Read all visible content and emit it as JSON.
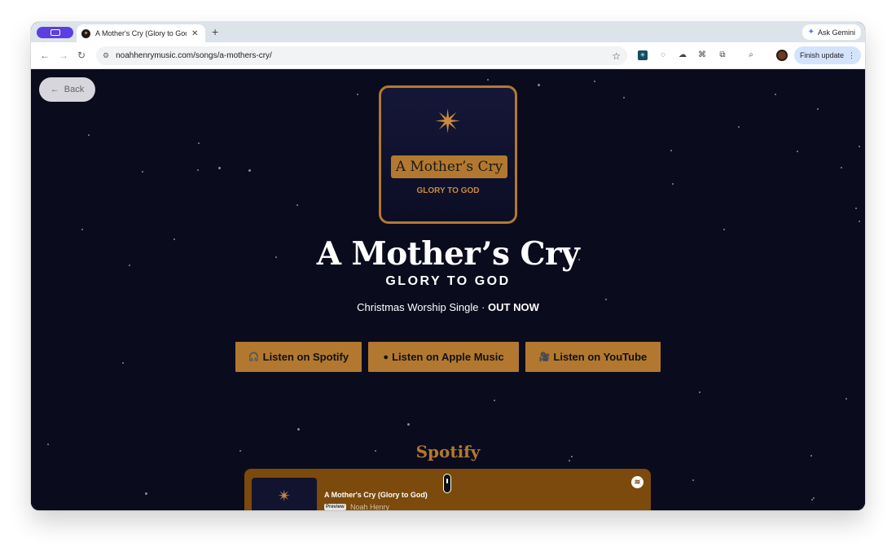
{
  "browser": {
    "tab_title": "A Mother's Cry (Glory to God",
    "favicon_glyph": "✦",
    "new_tab": "+",
    "ask_gemini": "Ask Gemini",
    "url": "noahhenrymusic.com/songs/a-mothers-cry/",
    "finish_update": "Finish update",
    "icons": [
      "back-arrow-icon",
      "forward-arrow-icon",
      "reload-icon",
      "site-settings-icon",
      "bookmark-star-icon",
      "extension-icon",
      "puzzle-icon",
      "tab-search-icon",
      "profile-avatar",
      "more-menu-icon"
    ]
  },
  "page": {
    "back_label": "Back",
    "cover": {
      "plate": "A Mother’s Cry",
      "sub": "GLORY TO GOD"
    },
    "title": "A Mother’s Cry",
    "subtitle": "GLORY TO GOD",
    "tagline_text": "Christmas Worship Single · ",
    "tagline_bold": "OUT NOW",
    "buttons": [
      {
        "icon": "🎧",
        "label": "Listen on Spotify"
      },
      {
        "icon": "",
        "label": "Listen on Apple Music"
      },
      {
        "icon": "🎥",
        "label": "Listen on YouTube"
      }
    ],
    "spotify_heading": "Spotify",
    "embed": {
      "track": "A Mother's Cry (Glory to God)",
      "preview": "Preview",
      "artist": "Noah Henry"
    },
    "accent_color": "#b3782f",
    "background_color": "#0b0b1e"
  }
}
